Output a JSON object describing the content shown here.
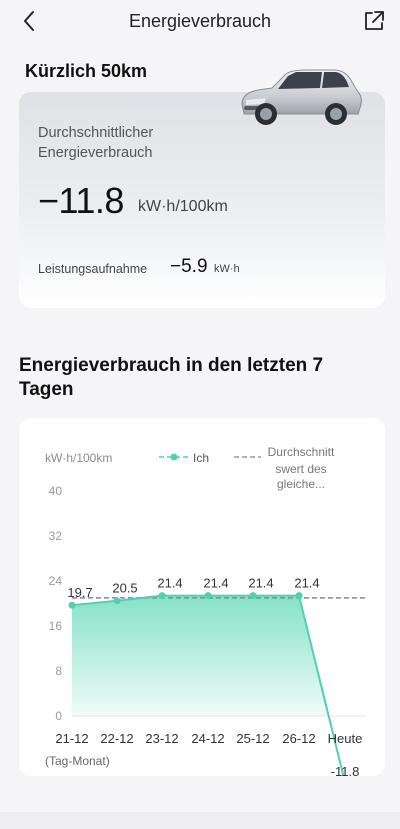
{
  "header": {
    "title": "Energieverbrauch",
    "back_icon": "chevron-left-icon",
    "share_icon": "share-external-icon"
  },
  "recent": {
    "title": "Kürzlich 50km",
    "avg_label": "Durchschnittlicher Energieverbrauch",
    "avg_value": "−11.8",
    "avg_unit": "kW·h/100km",
    "power_label": "Leistungsaufnahme",
    "power_value": "−5.9",
    "power_unit": "kW·h"
  },
  "week": {
    "title": "Energieverbrauch in den letzten 7 Tagen",
    "unit_label": "kW·h/100km",
    "x_axis_note": "(Tag-Monat)"
  },
  "colors": {
    "accent": "#4fd1b0",
    "accent_fill_top": "#7fe0c4",
    "average_line": "#888888"
  },
  "chart_data": {
    "type": "area",
    "categories": [
      "21-12",
      "22-12",
      "23-12",
      "24-12",
      "25-12",
      "26-12",
      "Heute"
    ],
    "series": [
      {
        "name": "Ich",
        "values": [
          19.7,
          20.5,
          21.4,
          21.4,
          21.4,
          21.4,
          -11.8
        ]
      },
      {
        "name": "Durchschnittswert des gleiche...",
        "values": [
          21.0,
          21.0,
          21.0,
          21.0,
          21.0,
          21.0,
          21.0
        ]
      }
    ],
    "data_labels": [
      "19.7",
      "20.5",
      "21.4",
      "21.4",
      "21.4",
      "21.4",
      "-11.8"
    ],
    "yticks": [
      0,
      8,
      16,
      24,
      32,
      40
    ],
    "ylim": [
      0,
      40
    ],
    "legend": {
      "me": "Ich",
      "avg_line1": "Durchschnitt",
      "avg_line2": "swert des",
      "avg_line3": "gleiche..."
    },
    "legend_position": "top-right",
    "grid": false
  }
}
